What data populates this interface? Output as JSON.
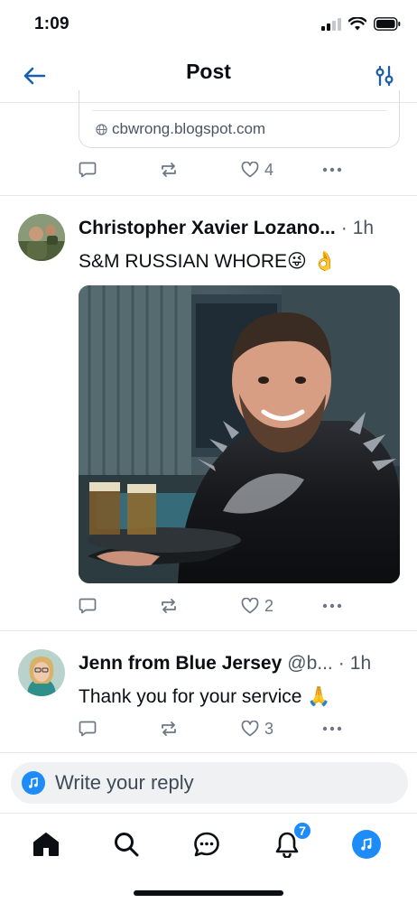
{
  "status_bar": {
    "time": "1:09"
  },
  "header": {
    "title": "Post"
  },
  "link_card": {
    "domain": "cbwrong.blogspot.com"
  },
  "prev_post": {
    "likes": "4"
  },
  "posts": [
    {
      "author": "Christopher Xavier Lozano...",
      "separator": "·",
      "time": "1h",
      "text": "S&M RUSSIAN WHORE",
      "emojis": "😜 👌",
      "likes": "2"
    },
    {
      "author": "Jenn from Blue Jersey",
      "handle": "@b...",
      "separator": "·",
      "time": "1h",
      "text": "Thank you for your service",
      "emojis": "🙏",
      "likes": "3"
    }
  ],
  "composer": {
    "placeholder": "Write your reply"
  },
  "tabs": {
    "notifications_badge": "7"
  },
  "colors": {
    "accent": "#1d8cf8",
    "muted": "#6b7785",
    "divider": "#e6e8eb"
  },
  "icons": [
    "back-arrow-icon",
    "sliders-icon",
    "reply-icon",
    "repost-icon",
    "heart-icon",
    "more-icon",
    "globe-icon",
    "home-icon",
    "search-icon",
    "chat-icon",
    "bell-icon"
  ]
}
